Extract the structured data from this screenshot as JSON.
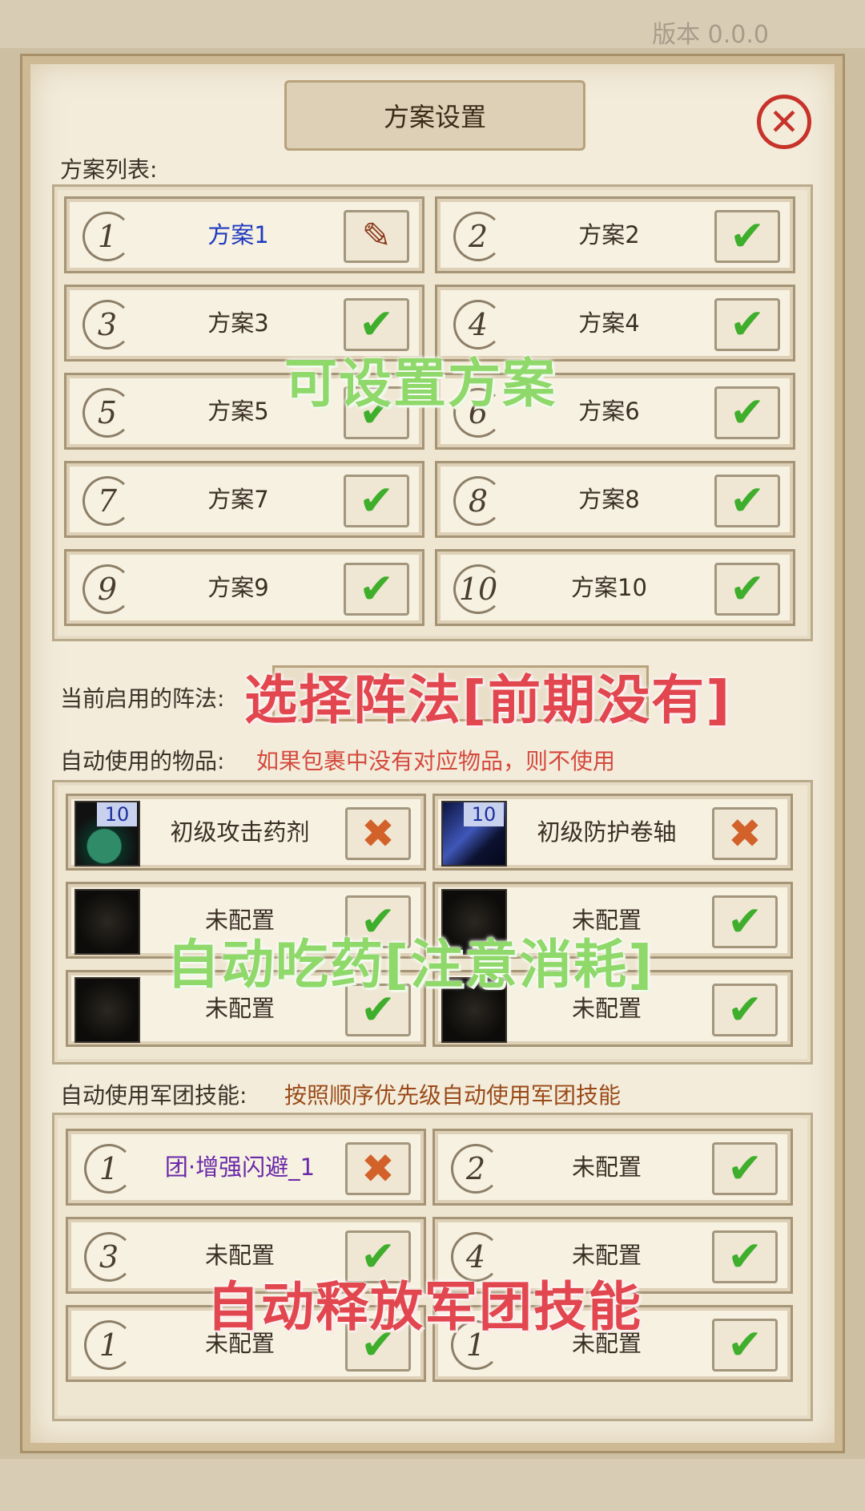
{
  "version_text": "版本 0.0.0",
  "title": "方案设置",
  "plan_list_label": "方案列表:",
  "plans": [
    {
      "num": "1",
      "name": "方案1",
      "state": "edit"
    },
    {
      "num": "2",
      "name": "方案2",
      "state": "check"
    },
    {
      "num": "3",
      "name": "方案3",
      "state": "check"
    },
    {
      "num": "4",
      "name": "方案4",
      "state": "check"
    },
    {
      "num": "5",
      "name": "方案5",
      "state": "check"
    },
    {
      "num": "6",
      "name": "方案6",
      "state": "check"
    },
    {
      "num": "7",
      "name": "方案7",
      "state": "check"
    },
    {
      "num": "8",
      "name": "方案8",
      "state": "check"
    },
    {
      "num": "9",
      "name": "方案9",
      "state": "check"
    },
    {
      "num": "10",
      "name": "方案10",
      "state": "check"
    }
  ],
  "formation_label": "当前启用的阵法:",
  "items_label": "自动使用的物品:",
  "items_hint": "如果包裹中没有对应物品，则不使用",
  "items": [
    {
      "name": "初级攻击药剂",
      "count": "10",
      "icon": "potion-icon",
      "state": "cross"
    },
    {
      "name": "初级防护卷轴",
      "count": "10",
      "icon": "scroll-icon",
      "state": "cross"
    },
    {
      "name": "未配置",
      "count": "",
      "icon": "empty-slot-icon",
      "state": "check"
    },
    {
      "name": "未配置",
      "count": "",
      "icon": "empty-slot-icon",
      "state": "check"
    },
    {
      "name": "未配置",
      "count": "",
      "icon": "empty-slot-icon",
      "state": "check"
    },
    {
      "name": "未配置",
      "count": "",
      "icon": "empty-slot-icon",
      "state": "check"
    }
  ],
  "skills_label": "自动使用军团技能:",
  "skills_hint": "按照顺序优先级自动使用军团技能",
  "skills": [
    {
      "num": "1",
      "name": "团·增强闪避_1",
      "state": "cross"
    },
    {
      "num": "2",
      "name": "未配置",
      "state": "check"
    },
    {
      "num": "3",
      "name": "未配置",
      "state": "check"
    },
    {
      "num": "4",
      "name": "未配置",
      "state": "check"
    },
    {
      "num": "1",
      "name": "未配置",
      "state": "check"
    },
    {
      "num": "1",
      "name": "未配置",
      "state": "check"
    }
  ],
  "overlays": {
    "plans": "可设置方案",
    "formation": "选择阵法[前期没有]",
    "items": "自动吃药[注意消耗]",
    "skills": "自动释放军团技能"
  },
  "icons": {
    "check": "✔",
    "cross": "✖",
    "edit": "✎",
    "close": "✕"
  },
  "colors": {
    "check": "#3fae2c",
    "cross": "#d2612a",
    "hint": "#d44a3e",
    "skills_hint": "#9a4a18",
    "plan1": "#1f3ac0",
    "skill1": "#6a2aa8"
  }
}
